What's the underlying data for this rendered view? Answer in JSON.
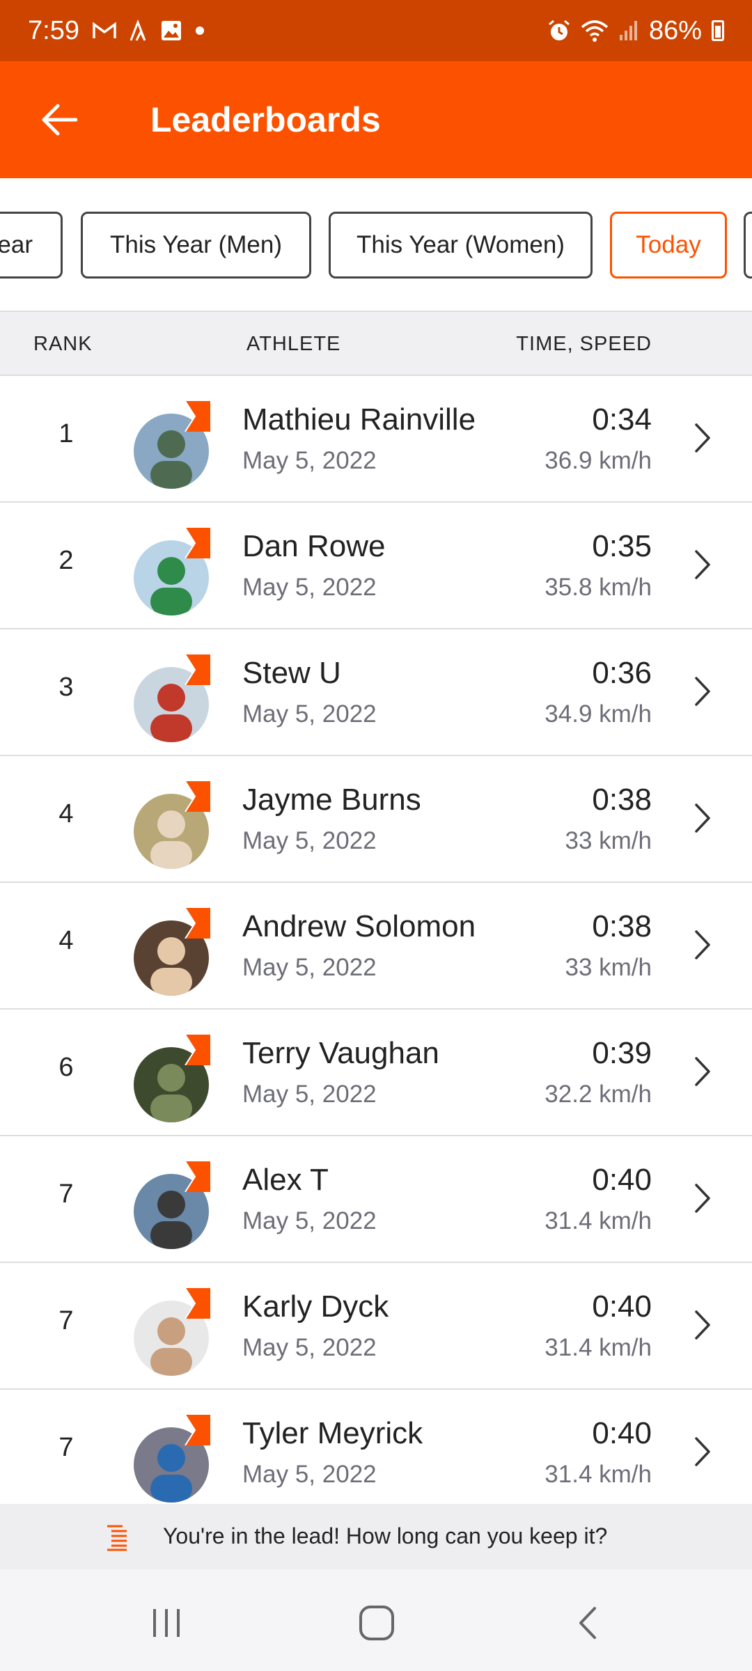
{
  "status_bar": {
    "time": "7:59",
    "battery": "86%",
    "left_icons": [
      "gmail-icon",
      "strava-icon",
      "gallery-icon",
      "dot-icon"
    ],
    "right_icons": [
      "alarm-icon",
      "wifi-icon",
      "signal-icon",
      "battery-icon"
    ]
  },
  "app_bar": {
    "title": "Leaderboards",
    "back_icon": "arrow-left-icon",
    "color": "#fc5200"
  },
  "filters": [
    {
      "label": "Year",
      "active": false
    },
    {
      "label": "This Year (Men)",
      "active": false
    },
    {
      "label": "This Year (Women)",
      "active": false
    },
    {
      "label": "Today",
      "active": true
    },
    {
      "label": "",
      "active": false
    }
  ],
  "table": {
    "headers": {
      "rank": "RANK",
      "athlete": "ATHLETE",
      "time_speed": "TIME, SPEED"
    },
    "rows": [
      {
        "rank": "1",
        "name": "Mathieu Rainville",
        "date": "May 5, 2022",
        "time": "0:34",
        "speed": "36.9 km/h"
      },
      {
        "rank": "2",
        "name": "Dan Rowe",
        "date": "May 5, 2022",
        "time": "0:35",
        "speed": "35.8 km/h"
      },
      {
        "rank": "3",
        "name": "Stew U",
        "date": "May 5, 2022",
        "time": "0:36",
        "speed": "34.9 km/h"
      },
      {
        "rank": "4",
        "name": "Jayme Burns",
        "date": "May 5, 2022",
        "time": "0:38",
        "speed": "33 km/h"
      },
      {
        "rank": "4",
        "name": "Andrew Solomon",
        "date": "May 5, 2022",
        "time": "0:38",
        "speed": "33 km/h"
      },
      {
        "rank": "6",
        "name": "Terry Vaughan",
        "date": "May 5, 2022",
        "time": "0:39",
        "speed": "32.2 km/h"
      },
      {
        "rank": "7",
        "name": "Alex T",
        "date": "May 5, 2022",
        "time": "0:40",
        "speed": "31.4 km/h"
      },
      {
        "rank": "7",
        "name": "Karly Dyck",
        "date": "May 5, 2022",
        "time": "0:40",
        "speed": "31.4 km/h"
      },
      {
        "rank": "7",
        "name": "Tyler Meyrick",
        "date": "May 5, 2022",
        "time": "0:40",
        "speed": "31.4 km/h"
      }
    ]
  },
  "footer": {
    "message": "You're in the lead!  How long can you keep it?",
    "icon": "list-icon"
  },
  "nav_bar": {
    "icons": [
      "recents-icon",
      "home-icon",
      "back-icon"
    ]
  }
}
